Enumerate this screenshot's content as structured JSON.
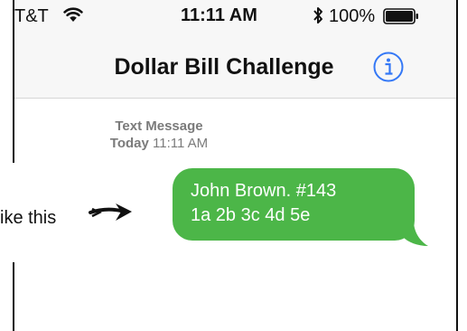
{
  "status_bar": {
    "carrier": "T&T",
    "time": "11:11 AM",
    "battery_percent": "100%",
    "icons": [
      "wifi-icon",
      "bluetooth-icon",
      "battery-icon"
    ]
  },
  "nav": {
    "title": "Dollar Bill Challenge",
    "info_icon": "info-icon"
  },
  "conversation": {
    "header_type": "Text Message",
    "header_day": "Today",
    "header_time": "11:11 AM",
    "message_line1": "John Brown. #143",
    "message_line2": "1a 2b 3c 4d 5e"
  },
  "annotation": {
    "text": "ike this",
    "arrow_icon": "arrow-right-icon"
  },
  "colors": {
    "bubble": "#4cb648",
    "info_accent": "#3478f6",
    "header_gray": "#7b7b7b"
  }
}
